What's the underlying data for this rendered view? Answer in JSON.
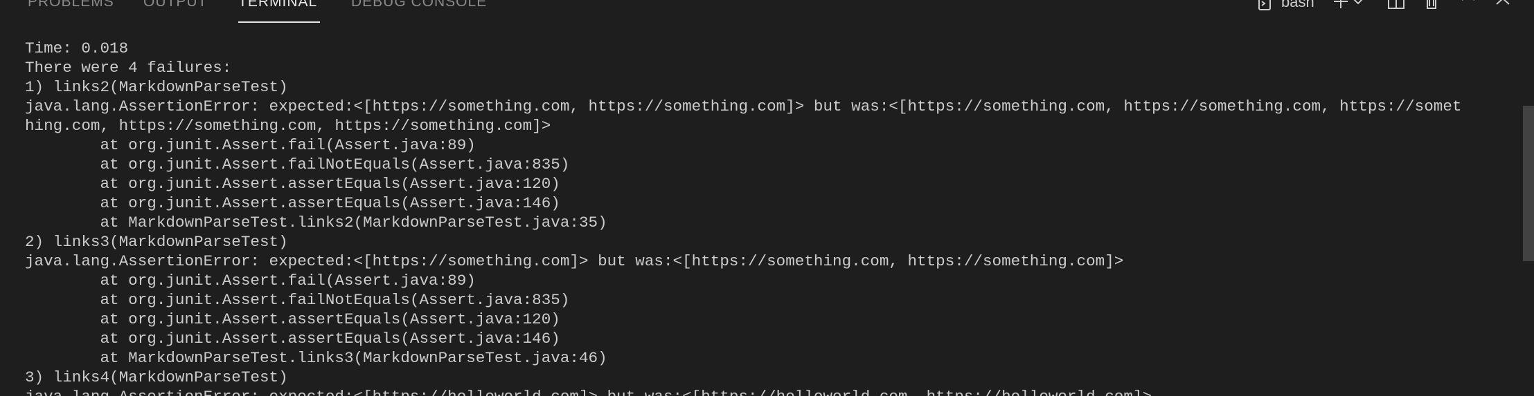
{
  "panel": {
    "tabs": [
      {
        "label": "PROBLEMS"
      },
      {
        "label": "OUTPUT"
      },
      {
        "label": "TERMINAL"
      },
      {
        "label": "DEBUG CONSOLE"
      }
    ],
    "active_tab": "TERMINAL",
    "shell_label": "bash"
  },
  "terminal": {
    "lines": [
      "Time: 0.018",
      "There were 4 failures:",
      "1) links2(MarkdownParseTest)",
      "java.lang.AssertionError: expected:<[https://something.com, https://something.com]> but was:<[https://something.com, https://something.com, https://somet",
      "hing.com, https://something.com, https://something.com]>",
      "        at org.junit.Assert.fail(Assert.java:89)",
      "        at org.junit.Assert.failNotEquals(Assert.java:835)",
      "        at org.junit.Assert.assertEquals(Assert.java:120)",
      "        at org.junit.Assert.assertEquals(Assert.java:146)",
      "        at MarkdownParseTest.links2(MarkdownParseTest.java:35)",
      "2) links3(MarkdownParseTest)",
      "java.lang.AssertionError: expected:<[https://something.com]> but was:<[https://something.com, https://something.com]>",
      "        at org.junit.Assert.fail(Assert.java:89)",
      "        at org.junit.Assert.failNotEquals(Assert.java:835)",
      "        at org.junit.Assert.assertEquals(Assert.java:120)",
      "        at org.junit.Assert.assertEquals(Assert.java:146)",
      "        at MarkdownParseTest.links3(MarkdownParseTest.java:46)",
      "3) links4(MarkdownParseTest)",
      "java.lang.AssertionError: expected:<[https://helloworld.com]> but was:<[https://helloworld.com, https://helloworld.com]>"
    ]
  }
}
